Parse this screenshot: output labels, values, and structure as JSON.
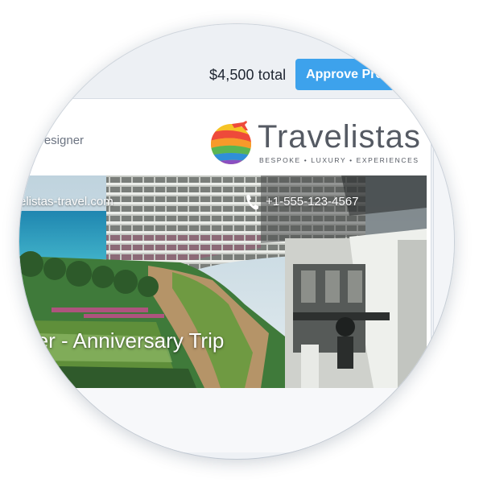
{
  "header": {
    "total": "$4,500 total",
    "approve_label": "Approve Proposal"
  },
  "designer": {
    "title": "ce Designer",
    "company": "vel"
  },
  "brand": {
    "name": "Travelistas",
    "tagline": "BESPOKE • LUXURY • EXPERIENCES",
    "logo_icon": "globe-airplane-icon"
  },
  "contact": {
    "website": "elistas-travel.com",
    "phone": "+1-555-123-4567",
    "phone_icon": "phone-icon"
  },
  "trip": {
    "title": "ofer - Anniversary Trip"
  },
  "colors": {
    "accent": "#3da2ec",
    "text_dark": "#1d2430",
    "text_muted": "#6c7482",
    "logo_text": "#555a63"
  }
}
